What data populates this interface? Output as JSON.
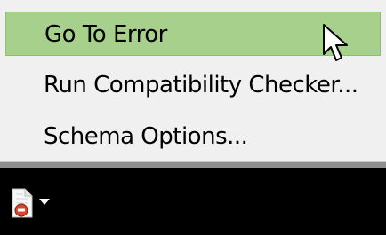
{
  "context_menu": {
    "items": [
      {
        "label": "Go To Error",
        "highlighted": true
      },
      {
        "label": "Run Compatibility Checker..."
      },
      {
        "label": "Schema Options..."
      }
    ],
    "highlight_color": "#a8d08d"
  },
  "toolbar": {
    "icon": "document-error-icon",
    "dropdown_icon": "chevron-down-icon"
  }
}
